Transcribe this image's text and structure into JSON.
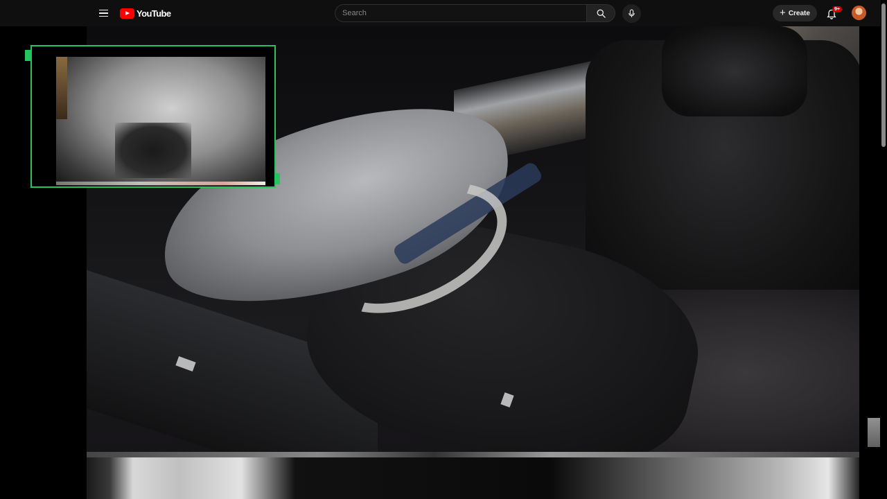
{
  "header": {
    "logo_text": "YouTube",
    "search_placeholder": "Search",
    "create_label": "Create",
    "notification_badge": "9+"
  },
  "icons": {
    "menu": "hamburger-menu-icon",
    "logo": "youtube-logo-icon",
    "search": "search-icon",
    "mic": "microphone-icon",
    "create": "plus-icon",
    "notifications": "bell-icon",
    "avatar": "user-avatar"
  },
  "colors": {
    "topbar_bg": "#0f0f0f",
    "brand_red": "#ff0000",
    "pip_border": "#22c55e",
    "badge_red": "#cc0000"
  }
}
